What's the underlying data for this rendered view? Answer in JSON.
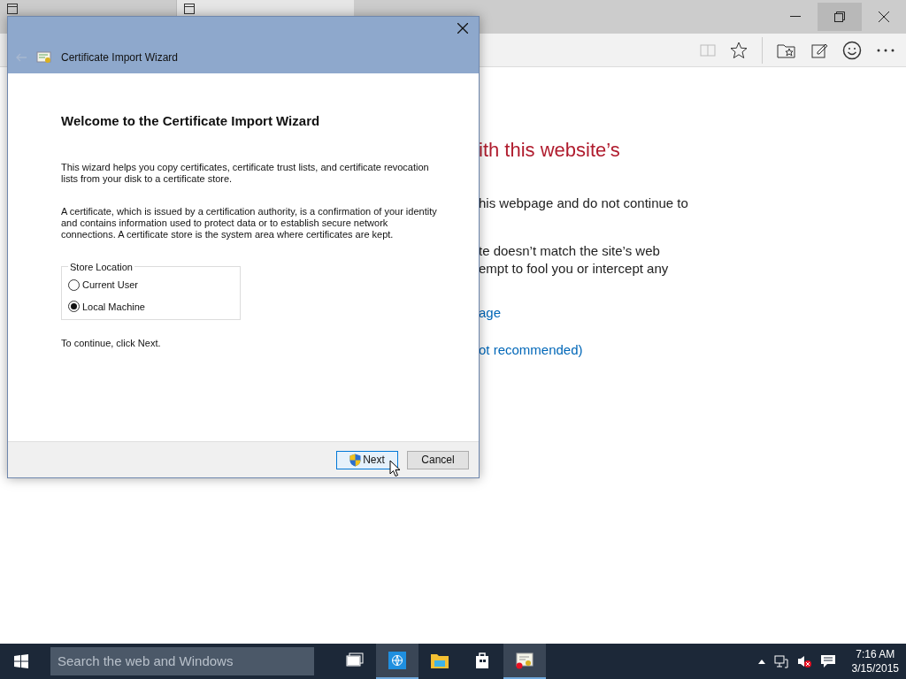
{
  "browser": {
    "tabs": [
      {
        "selected": false
      },
      {
        "selected": true
      }
    ],
    "page": {
      "heading": "ith this website’s",
      "paragraphs": [
        "his webpage and do not continue to",
        "te doesn’t match the site’s web\nempt to fool you or intercept any"
      ],
      "links": [
        "age",
        "ot recommended)"
      ]
    }
  },
  "dialog": {
    "title": "Certificate Import Wizard",
    "heading": "Welcome to the Certificate Import Wizard",
    "paragraphs": [
      "This wizard helps you copy certificates, certificate trust lists, and certificate revocation lists from your disk to a certificate store.",
      "A certificate, which is issued by a certification authority, is a confirmation of your identity and contains information used to protect data or to establish secure network connections. A certificate store is the system area where certificates are kept."
    ],
    "store_location": {
      "label": "Store Location",
      "options": [
        {
          "label": "Current User",
          "selected": false
        },
        {
          "label": "Local Machine",
          "selected": true
        }
      ]
    },
    "hint": "To continue, click Next.",
    "buttons": [
      {
        "label": "Next",
        "kind": "shield",
        "focused": true
      },
      {
        "label": "Cancel",
        "kind": "plain",
        "focused": false
      }
    ]
  },
  "taskbar": {
    "search": {
      "placeholder": "Search the web and Windows"
    },
    "apps": [
      {
        "kind": "taskview",
        "active": false
      },
      {
        "kind": "browser",
        "active": true
      },
      {
        "kind": "folder",
        "active": false
      },
      {
        "kind": "store",
        "active": false
      },
      {
        "kind": "certificate",
        "active": true
      }
    ],
    "clock": {
      "time": "7:16 AM",
      "date": "3/15/2015"
    }
  }
}
